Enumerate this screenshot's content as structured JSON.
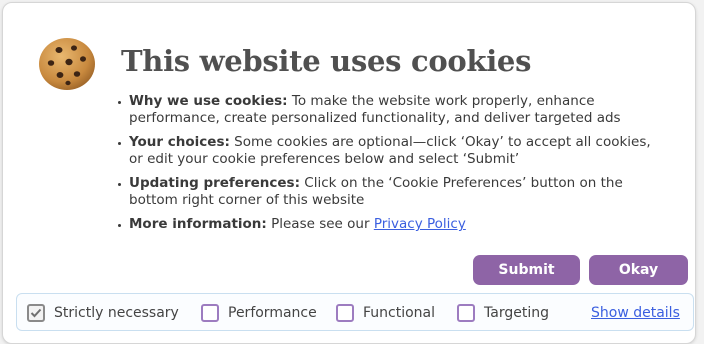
{
  "banner": {
    "title": "This website uses cookies",
    "icon": "cookie-icon",
    "items": [
      {
        "heading": "Why we use cookies:",
        "text": " To make the website work properly, enhance performance, create personalized functionality, and deliver targeted ads"
      },
      {
        "heading": "Your choices:",
        "text": " Some cookies are optional—click ‘Okay’ to accept all cookies, or edit your cookie preferences below and select ‘Submit’"
      },
      {
        "heading": "Updating preferences:",
        "text": " Click on the ‘Cookie Preferences’ button on the bottom right corner of this website"
      },
      {
        "heading": "More information:",
        "text": " Please see our ",
        "link": "Privacy Policy"
      }
    ]
  },
  "buttons": {
    "submit": "Submit",
    "okay": "Okay"
  },
  "preferences": {
    "options": [
      {
        "label": "Strictly necessary",
        "checked": true
      },
      {
        "label": "Performance",
        "checked": false
      },
      {
        "label": "Functional",
        "checked": false
      },
      {
        "label": "Targeting",
        "checked": false
      }
    ],
    "show_details": "Show details"
  },
  "colors": {
    "accent": "#8e64a6",
    "link": "#3b5fe0",
    "title": "#505050",
    "checkbox_border": "#9d7cc0"
  }
}
